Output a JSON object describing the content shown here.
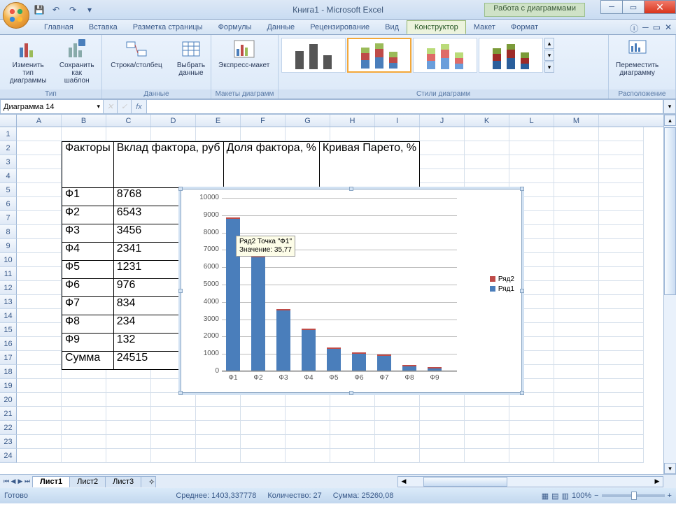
{
  "title": "Книга1 - Microsoft Excel",
  "chart_tools_label": "Работа с диаграммами",
  "tabs": [
    "Главная",
    "Вставка",
    "Разметка страницы",
    "Формулы",
    "Данные",
    "Рецензирование",
    "Вид",
    "Конструктор",
    "Макет",
    "Формат"
  ],
  "active_tab": "Конструктор",
  "ribbon": {
    "type_group": "Тип",
    "change_type": "Изменить тип\nдиаграммы",
    "save_template": "Сохранить\nкак шаблон",
    "data_group": "Данные",
    "switch_rowcol": "Строка/столбец",
    "select_data": "Выбрать\nданные",
    "layouts_group": "Макеты диаграмм",
    "express_layout": "Экспресс-макет",
    "styles_group": "Стили диаграмм",
    "location_group": "Расположение",
    "move_chart": "Переместить\nдиаграмму"
  },
  "namebox": "Диаграмма 14",
  "columns": [
    "A",
    "B",
    "C",
    "D",
    "E",
    "F",
    "G",
    "H",
    "I",
    "J",
    "K",
    "L",
    "M"
  ],
  "table_headers": [
    "Факторы",
    "Вклад фактора, руб",
    "Доля фактора, %",
    "Кривая Парето, %"
  ],
  "table_rows": [
    {
      "f": "Ф1",
      "v": "8768"
    },
    {
      "f": "Ф2",
      "v": "6543"
    },
    {
      "f": "Ф3",
      "v": "3456"
    },
    {
      "f": "Ф4",
      "v": "2341"
    },
    {
      "f": "Ф5",
      "v": "1231"
    },
    {
      "f": "Ф6",
      "v": "976"
    },
    {
      "f": "Ф7",
      "v": "834"
    },
    {
      "f": "Ф8",
      "v": "234"
    },
    {
      "f": "Ф9",
      "v": "132"
    }
  ],
  "table_sum_label": "Сумма",
  "table_sum_value": "24515",
  "tooltip_line1": "Ряд2 Точка \"Ф1\"",
  "tooltip_line2": "Значение: 35,77",
  "legend": {
    "r1": "Ряд1",
    "r2": "Ряд2"
  },
  "sheets": [
    "Лист1",
    "Лист2",
    "Лист3"
  ],
  "status_ready": "Готово",
  "status_avg": "Среднее: 1403,337778",
  "status_count": "Количество: 27",
  "status_sum": "Сумма: 25260,08",
  "zoom": "100%",
  "chart_data": {
    "type": "bar",
    "categories": [
      "Ф1",
      "Ф2",
      "Ф3",
      "Ф4",
      "Ф5",
      "Ф6",
      "Ф7",
      "Ф8",
      "Ф9"
    ],
    "series": [
      {
        "name": "Ряд1",
        "values": [
          8768,
          6543,
          3456,
          2341,
          1231,
          976,
          834,
          234,
          132
        ]
      },
      {
        "name": "Ряд2",
        "values": [
          35.77,
          26.69,
          14.1,
          9.55,
          5.02,
          3.98,
          3.4,
          0.95,
          0.54
        ]
      }
    ],
    "ylim": [
      0,
      10000
    ],
    "ystep": 1000,
    "xlabel": "",
    "ylabel": "",
    "title": ""
  }
}
